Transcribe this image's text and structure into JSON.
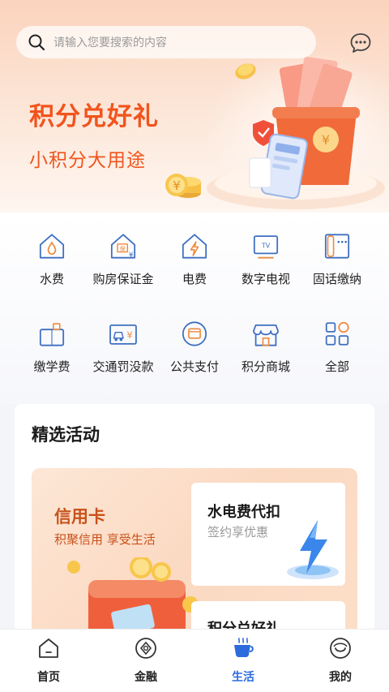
{
  "search": {
    "placeholder": "请输入您要搜索的内容"
  },
  "banner": {
    "title": "积分兑好礼",
    "subtitle": "小积分大用途"
  },
  "services": [
    {
      "label": "水费",
      "icon": "water-house-icon"
    },
    {
      "label": "购房保证金",
      "icon": "house-deposit-icon"
    },
    {
      "label": "电费",
      "icon": "electric-house-icon"
    },
    {
      "label": "数字电视",
      "icon": "tv-icon"
    },
    {
      "label": "固话缴纳",
      "icon": "landline-phone-icon"
    },
    {
      "label": "缴学费",
      "icon": "tuition-icon"
    },
    {
      "label": "交通罚没款",
      "icon": "traffic-fine-icon"
    },
    {
      "label": "公共支付",
      "icon": "public-payment-icon"
    },
    {
      "label": "积分商城",
      "icon": "points-mall-icon"
    },
    {
      "label": "全部",
      "icon": "all-apps-icon"
    }
  ],
  "featured": {
    "title": "精选活动",
    "promo": {
      "title": "信用卡",
      "subtitle": "积聚信用  享受生活"
    },
    "cards": [
      {
        "title": "水电费代扣",
        "subtitle": "签约享优惠"
      },
      {
        "title": "积分兑好礼",
        "subtitle": ""
      }
    ]
  },
  "tabs": [
    {
      "label": "首页",
      "icon": "home-icon",
      "active": false
    },
    {
      "label": "金融",
      "icon": "finance-icon",
      "active": false
    },
    {
      "label": "生活",
      "icon": "life-cup-icon",
      "active": true
    },
    {
      "label": "我的",
      "icon": "profile-face-icon",
      "active": false
    }
  ],
  "colors": {
    "accent": "#2b6bdc",
    "brand_orange": "#f1541d",
    "icon_blue": "#3f6fc0",
    "icon_orange": "#f08a3c"
  }
}
